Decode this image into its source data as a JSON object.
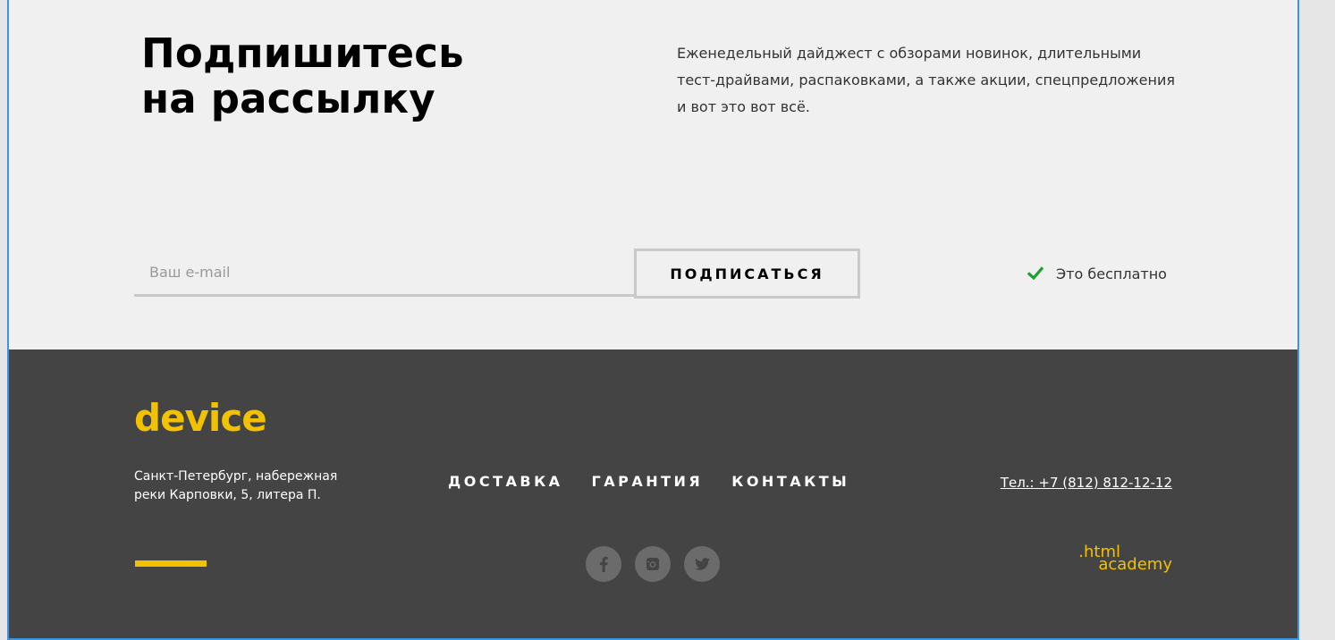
{
  "subscribe": {
    "title_line1": "Подпишитесь",
    "title_line2": "на рассылку",
    "description": "Еженедельный дайджест с обзорами новинок, длительными тест-драйвами, распаковками, а также акции, спецпредложения и вот это вот всё.",
    "email_placeholder": "Ваш e-mail",
    "email_value": "",
    "button_label": "ПОДПИСАТЬСЯ",
    "free_note": "Это бесплатно"
  },
  "footer": {
    "logo": "device",
    "address": "Санкт-Петербург, набережная реки Карповки, 5, литера П.",
    "nav": [
      {
        "label": "ДОСТАВКА"
      },
      {
        "label": "ГАРАНТИЯ"
      },
      {
        "label": "КОНТАКТЫ"
      }
    ],
    "phone": "Тел.: +7 (812) 812-12-12",
    "socials": [
      "facebook-icon",
      "instagram-icon",
      "twitter-icon"
    ],
    "academy_logo": {
      "line1": ".html",
      "line2": "academy"
    }
  },
  "colors": {
    "accent": "#f2c200",
    "footer_bg": "#444444",
    "page_bg": "#f0f0f0",
    "check": "#1aa32a",
    "frame_border": "#3d95e0"
  }
}
